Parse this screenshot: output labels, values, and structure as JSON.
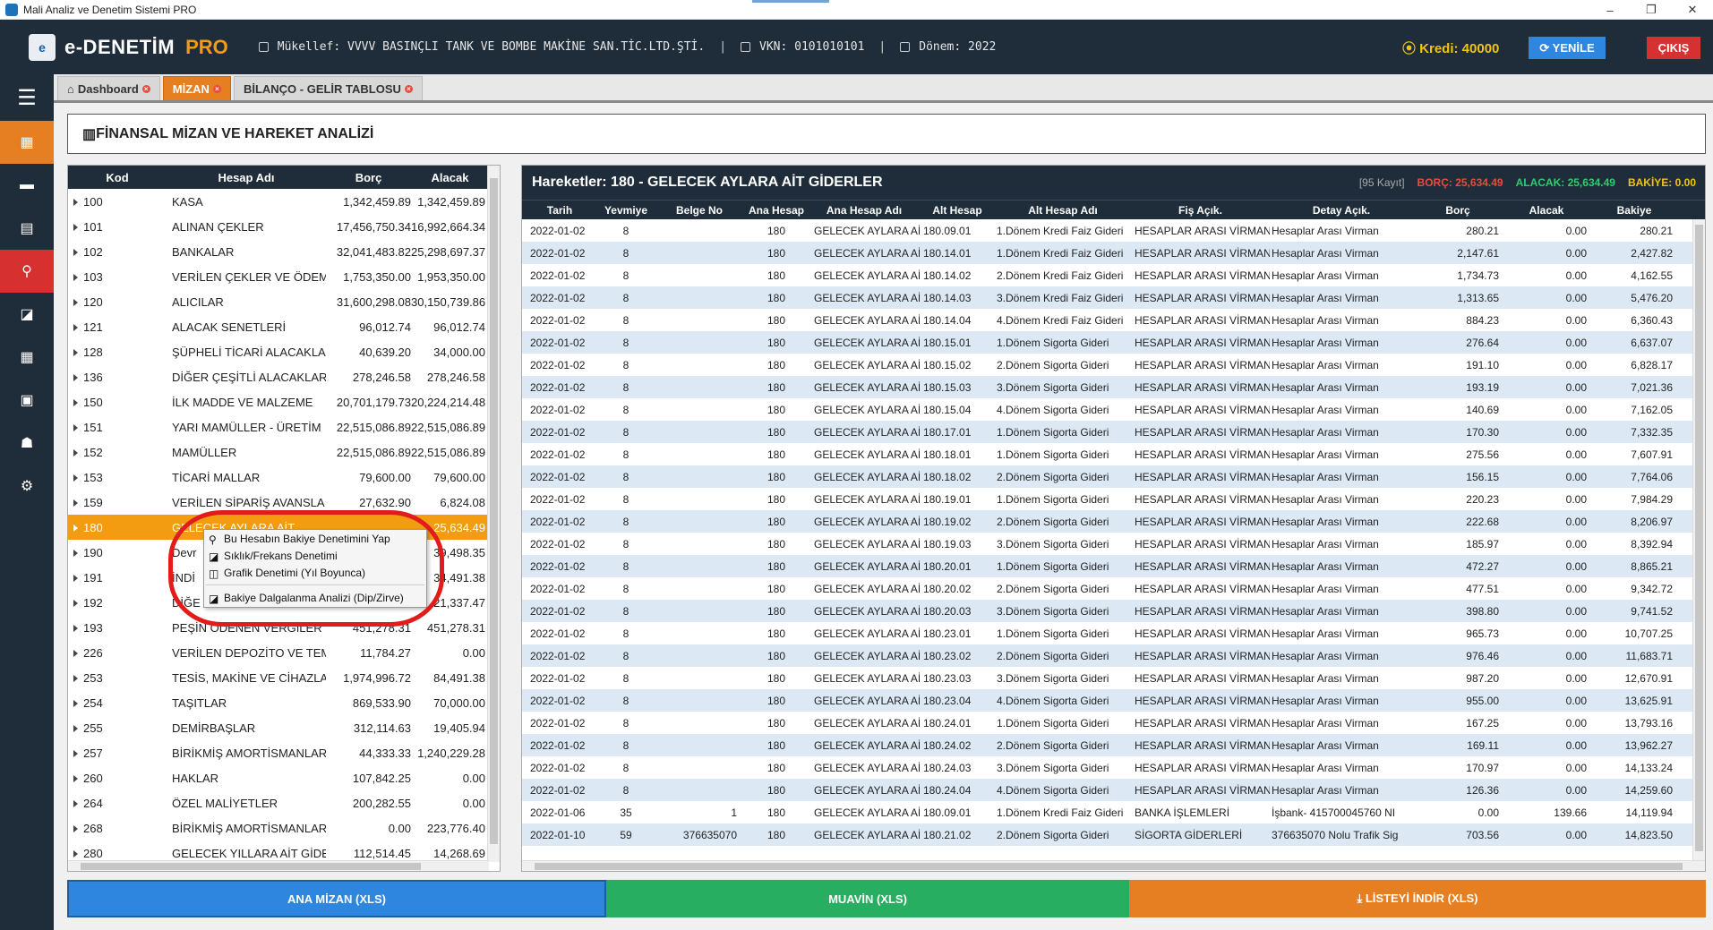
{
  "window": {
    "title": "Mali Analiz ve Denetim Sistemi PRO",
    "controls": [
      "–",
      "❐",
      "✕"
    ]
  },
  "header": {
    "brand": "e-DENETİM",
    "brand_suffix": "PRO",
    "mukellef": "Mükellef: VVVV BASINÇLI TANK VE BOMBE MAKİNE SAN.TİC.LTD.ŞTİ.",
    "vkn": "VKN: 0101010101",
    "donem": "Dönem: 2022",
    "kredi": "Kredi: 40000",
    "yenile": "YENİLE",
    "cikis": "ÇIKIŞ",
    "colors": {
      "accent": "#f39c12",
      "header_bg": "#1f2d3a",
      "kredi": "#f1c40f"
    }
  },
  "tabs": [
    {
      "label": "Dashboard"
    },
    {
      "label": "MİZAN"
    },
    {
      "label": "BİLANÇO - GELİR TABLOSU"
    }
  ],
  "page_title": "FİNANSAL MİZAN VE HAREKET ANALİZİ",
  "mizan": {
    "headers": {
      "kod": "Kod",
      "ad": "Hesap Adı",
      "borc": "Borç",
      "alacak": "Alacak"
    },
    "rows": [
      {
        "kod": "100",
        "ad": "KASA",
        "borc": "1,342,459.89",
        "alacak": "1,342,459.89"
      },
      {
        "kod": "101",
        "ad": "ALINAN ÇEKLER",
        "borc": "17,456,750.34",
        "alacak": "16,992,664.34"
      },
      {
        "kod": "102",
        "ad": "BANKALAR",
        "borc": "32,041,483.82",
        "alacak": "25,298,697.37"
      },
      {
        "kod": "103",
        "ad": "VERİLEN ÇEKLER VE ÖDEM",
        "borc": "1,753,350.00",
        "alacak": "1,953,350.00"
      },
      {
        "kod": "120",
        "ad": "ALICILAR",
        "borc": "31,600,298.08",
        "alacak": "30,150,739.86"
      },
      {
        "kod": "121",
        "ad": "ALACAK SENETLERİ",
        "borc": "96,012.74",
        "alacak": "96,012.74"
      },
      {
        "kod": "128",
        "ad": "ŞÜPHELİ TİCARİ ALACAKLA",
        "borc": "40,639.20",
        "alacak": "34,000.00"
      },
      {
        "kod": "136",
        "ad": "DİĞER ÇEŞİTLİ ALACAKLAR",
        "borc": "278,246.58",
        "alacak": "278,246.58"
      },
      {
        "kod": "150",
        "ad": "İLK MADDE VE MALZEME",
        "borc": "20,701,179.73",
        "alacak": "20,224,214.48"
      },
      {
        "kod": "151",
        "ad": "YARI MAMÜLLER - ÜRETİM",
        "borc": "22,515,086.89",
        "alacak": "22,515,086.89"
      },
      {
        "kod": "152",
        "ad": "MAMÜLLER",
        "borc": "22,515,086.89",
        "alacak": "22,515,086.89"
      },
      {
        "kod": "153",
        "ad": "TİCARİ MALLAR",
        "borc": "79,600.00",
        "alacak": "79,600.00"
      },
      {
        "kod": "159",
        "ad": "VERİLEN SİPARİŞ AVANSLA",
        "borc": "27,632.90",
        "alacak": "6,824.08"
      },
      {
        "kod": "180",
        "ad": "GELECEK AYLARA AİT",
        "borc": "",
        "alacak": "25,634.49",
        "selected": true
      },
      {
        "kod": "190",
        "ad": "Devr",
        "borc": "",
        "alacak": "39,498.35"
      },
      {
        "kod": "191",
        "ad": "İNDİ",
        "borc": "",
        "alacak": "34,491.38"
      },
      {
        "kod": "192",
        "ad": "DİĞE",
        "borc": "",
        "alacak": "21,337.47"
      },
      {
        "kod": "193",
        "ad": "PEŞİN ÖDENEN VERGİLER",
        "borc": "451,278.31",
        "alacak": "451,278.31"
      },
      {
        "kod": "226",
        "ad": "VERİLEN DEPOZİTO VE TEM",
        "borc": "11,784.27",
        "alacak": "0.00"
      },
      {
        "kod": "253",
        "ad": "TESİS, MAKİNE VE CİHAZLA",
        "borc": "1,974,996.72",
        "alacak": "84,491.38"
      },
      {
        "kod": "254",
        "ad": "TAŞITLAR",
        "borc": "869,533.90",
        "alacak": "70,000.00"
      },
      {
        "kod": "255",
        "ad": "DEMİRBAŞLAR",
        "borc": "312,114.63",
        "alacak": "19,405.94"
      },
      {
        "kod": "257",
        "ad": "BİRİKMİŞ AMORTİSMANLAR",
        "borc": "44,333.33",
        "alacak": "1,240,229.28"
      },
      {
        "kod": "260",
        "ad": "HAKLAR",
        "borc": "107,842.25",
        "alacak": "0.00"
      },
      {
        "kod": "264",
        "ad": "ÖZEL MALİYETLER",
        "borc": "200,282.55",
        "alacak": "0.00"
      },
      {
        "kod": "268",
        "ad": "BİRİKMİŞ AMORTİSMANLAR",
        "borc": "0.00",
        "alacak": "223,776.40"
      },
      {
        "kod": "280",
        "ad": "GELECEK YILLARA AİT GİDE",
        "borc": "112,514.45",
        "alacak": "14,268.69"
      }
    ]
  },
  "context_menu": {
    "items": [
      "Bu Hesabın Bakiye Denetimini Yap",
      "Sıklık/Frekans Denetimi",
      "Grafik Denetimi (Yıl Boyunca)",
      "Bakiye Dalgalanma Analizi (Dip/Zirve)"
    ]
  },
  "hareketler": {
    "title": "Hareketler: 180 - GELECEK AYLARA AİT GİDERLER",
    "kayit": "[95 Kayıt]",
    "borc_total": "BORÇ: 25,634.49",
    "alacak_total": "ALACAK: 25,634.49",
    "bakiye_total": "BAKİYE: 0.00",
    "headers": [
      "Tarih",
      "Yevmiye",
      "Belge No",
      "Ana Hesap",
      "Ana Hesap Adı",
      "Alt Hesap",
      "Alt Hesap Adı",
      "Fiş Açık.",
      "Detay Açık.",
      "Borç",
      "Alacak",
      "Bakiye"
    ],
    "rows": [
      [
        "2022-01-02",
        "8",
        "",
        "180",
        "GELECEK AYLARA AİT",
        "180.09.01",
        "1.Dönem Kredi Faiz Gideri",
        "HESAPLAR ARASI VİRMAN",
        "Hesaplar Arası Virman",
        "280.21",
        "0.00",
        "280.21"
      ],
      [
        "2022-01-02",
        "8",
        "",
        "180",
        "GELECEK AYLARA AİT",
        "180.14.01",
        "1.Dönem Kredi Faiz Gideri",
        "HESAPLAR ARASI VİRMAN",
        "Hesaplar Arası Virman",
        "2,147.61",
        "0.00",
        "2,427.82"
      ],
      [
        "2022-01-02",
        "8",
        "",
        "180",
        "GELECEK AYLARA AİT",
        "180.14.02",
        "2.Dönem Kredi Faiz Gideri",
        "HESAPLAR ARASI VİRMAN",
        "Hesaplar Arası Virman",
        "1,734.73",
        "0.00",
        "4,162.55"
      ],
      [
        "2022-01-02",
        "8",
        "",
        "180",
        "GELECEK AYLARA AİT",
        "180.14.03",
        "3.Dönem Kredi Faiz Gideri",
        "HESAPLAR ARASI VİRMAN",
        "Hesaplar Arası Virman",
        "1,313.65",
        "0.00",
        "5,476.20"
      ],
      [
        "2022-01-02",
        "8",
        "",
        "180",
        "GELECEK AYLARA AİT",
        "180.14.04",
        "4.Dönem Kredi Faiz Gideri",
        "HESAPLAR ARASI VİRMAN",
        "Hesaplar Arası Virman",
        "884.23",
        "0.00",
        "6,360.43"
      ],
      [
        "2022-01-02",
        "8",
        "",
        "180",
        "GELECEK AYLARA AİT",
        "180.15.01",
        "1.Dönem Sigorta Gideri",
        "HESAPLAR ARASI VİRMAN",
        "Hesaplar Arası Virman",
        "276.64",
        "0.00",
        "6,637.07"
      ],
      [
        "2022-01-02",
        "8",
        "",
        "180",
        "GELECEK AYLARA AİT",
        "180.15.02",
        "2.Dönem Sigorta Gideri",
        "HESAPLAR ARASI VİRMAN",
        "Hesaplar Arası Virman",
        "191.10",
        "0.00",
        "6,828.17"
      ],
      [
        "2022-01-02",
        "8",
        "",
        "180",
        "GELECEK AYLARA AİT",
        "180.15.03",
        "3.Dönem Sigorta Gideri",
        "HESAPLAR ARASI VİRMAN",
        "Hesaplar Arası Virman",
        "193.19",
        "0.00",
        "7,021.36"
      ],
      [
        "2022-01-02",
        "8",
        "",
        "180",
        "GELECEK AYLARA AİT",
        "180.15.04",
        "4.Dönem Sigorta Gideri",
        "HESAPLAR ARASI VİRMAN",
        "Hesaplar Arası Virman",
        "140.69",
        "0.00",
        "7,162.05"
      ],
      [
        "2022-01-02",
        "8",
        "",
        "180",
        "GELECEK AYLARA AİT",
        "180.17.01",
        "1.Dönem Sigorta Gideri",
        "HESAPLAR ARASI VİRMAN",
        "Hesaplar Arası Virman",
        "170.30",
        "0.00",
        "7,332.35"
      ],
      [
        "2022-01-02",
        "8",
        "",
        "180",
        "GELECEK AYLARA AİT",
        "180.18.01",
        "1.Dönem Sigorta Gideri",
        "HESAPLAR ARASI VİRMAN",
        "Hesaplar Arası Virman",
        "275.56",
        "0.00",
        "7,607.91"
      ],
      [
        "2022-01-02",
        "8",
        "",
        "180",
        "GELECEK AYLARA AİT",
        "180.18.02",
        "2.Dönem Sigorta Gideri",
        "HESAPLAR ARASI VİRMAN",
        "Hesaplar Arası Virman",
        "156.15",
        "0.00",
        "7,764.06"
      ],
      [
        "2022-01-02",
        "8",
        "",
        "180",
        "GELECEK AYLARA AİT",
        "180.19.01",
        "1.Dönem Sigorta Gideri",
        "HESAPLAR ARASI VİRMAN",
        "Hesaplar Arası Virman",
        "220.23",
        "0.00",
        "7,984.29"
      ],
      [
        "2022-01-02",
        "8",
        "",
        "180",
        "GELECEK AYLARA AİT",
        "180.19.02",
        "2.Dönem Sigorta Gideri",
        "HESAPLAR ARASI VİRMAN",
        "Hesaplar Arası Virman",
        "222.68",
        "0.00",
        "8,206.97"
      ],
      [
        "2022-01-02",
        "8",
        "",
        "180",
        "GELECEK AYLARA AİT",
        "180.19.03",
        "3.Dönem Sigorta Gideri",
        "HESAPLAR ARASI VİRMAN",
        "Hesaplar Arası Virman",
        "185.97",
        "0.00",
        "8,392.94"
      ],
      [
        "2022-01-02",
        "8",
        "",
        "180",
        "GELECEK AYLARA AİT",
        "180.20.01",
        "1.Dönem Sigorta Gideri",
        "HESAPLAR ARASI VİRMAN",
        "Hesaplar Arası Virman",
        "472.27",
        "0.00",
        "8,865.21"
      ],
      [
        "2022-01-02",
        "8",
        "",
        "180",
        "GELECEK AYLARA AİT",
        "180.20.02",
        "2.Dönem Sigorta Gideri",
        "HESAPLAR ARASI VİRMAN",
        "Hesaplar Arası Virman",
        "477.51",
        "0.00",
        "9,342.72"
      ],
      [
        "2022-01-02",
        "8",
        "",
        "180",
        "GELECEK AYLARA AİT",
        "180.20.03",
        "3.Dönem Sigorta Gideri",
        "HESAPLAR ARASI VİRMAN",
        "Hesaplar Arası Virman",
        "398.80",
        "0.00",
        "9,741.52"
      ],
      [
        "2022-01-02",
        "8",
        "",
        "180",
        "GELECEK AYLARA AİT",
        "180.23.01",
        "1.Dönem Sigorta Gideri",
        "HESAPLAR ARASI VİRMAN",
        "Hesaplar Arası Virman",
        "965.73",
        "0.00",
        "10,707.25"
      ],
      [
        "2022-01-02",
        "8",
        "",
        "180",
        "GELECEK AYLARA AİT",
        "180.23.02",
        "2.Dönem Sigorta Gideri",
        "HESAPLAR ARASI VİRMAN",
        "Hesaplar Arası Virman",
        "976.46",
        "0.00",
        "11,683.71"
      ],
      [
        "2022-01-02",
        "8",
        "",
        "180",
        "GELECEK AYLARA AİT",
        "180.23.03",
        "3.Dönem Sigorta Gideri",
        "HESAPLAR ARASI VİRMAN",
        "Hesaplar Arası Virman",
        "987.20",
        "0.00",
        "12,670.91"
      ],
      [
        "2022-01-02",
        "8",
        "",
        "180",
        "GELECEK AYLARA AİT",
        "180.23.04",
        "4.Dönem Sigorta Gideri",
        "HESAPLAR ARASI VİRMAN",
        "Hesaplar Arası Virman",
        "955.00",
        "0.00",
        "13,625.91"
      ],
      [
        "2022-01-02",
        "8",
        "",
        "180",
        "GELECEK AYLARA AİT",
        "180.24.01",
        "1.Dönem Sigorta Gideri",
        "HESAPLAR ARASI VİRMAN",
        "Hesaplar Arası Virman",
        "167.25",
        "0.00",
        "13,793.16"
      ],
      [
        "2022-01-02",
        "8",
        "",
        "180",
        "GELECEK AYLARA AİT",
        "180.24.02",
        "2.Dönem Sigorta Gideri",
        "HESAPLAR ARASI VİRMAN",
        "Hesaplar Arası Virman",
        "169.11",
        "0.00",
        "13,962.27"
      ],
      [
        "2022-01-02",
        "8",
        "",
        "180",
        "GELECEK AYLARA AİT",
        "180.24.03",
        "3.Dönem Sigorta Gideri",
        "HESAPLAR ARASI VİRMAN",
        "Hesaplar Arası Virman",
        "170.97",
        "0.00",
        "14,133.24"
      ],
      [
        "2022-01-02",
        "8",
        "",
        "180",
        "GELECEK AYLARA AİT",
        "180.24.04",
        "4.Dönem Sigorta Gideri",
        "HESAPLAR ARASI VİRMAN",
        "Hesaplar Arası Virman",
        "126.36",
        "0.00",
        "14,259.60"
      ],
      [
        "2022-01-06",
        "35",
        "1",
        "180",
        "GELECEK AYLARA AİT",
        "180.09.01",
        "1.Dönem Kredi Faiz Gideri",
        "BANKA İŞLEMLERİ",
        "İşbank- 415700045760 NI",
        "0.00",
        "139.66",
        "14,119.94"
      ],
      [
        "2022-01-10",
        "59",
        "376635070",
        "180",
        "GELECEK AYLARA AİT",
        "180.21.02",
        "2.Dönem Sigorta Gideri",
        "SİGORTA GİDERLERİ",
        "376635070 Nolu Trafik Sig",
        "703.56",
        "0.00",
        "14,823.50"
      ]
    ]
  },
  "bottom": {
    "ana_mizan": "ANA MİZAN (XLS)",
    "muavin": "MUAVİN (XLS)",
    "listeyi_indir": "LİSTEYİ İNDİR (XLS)"
  }
}
